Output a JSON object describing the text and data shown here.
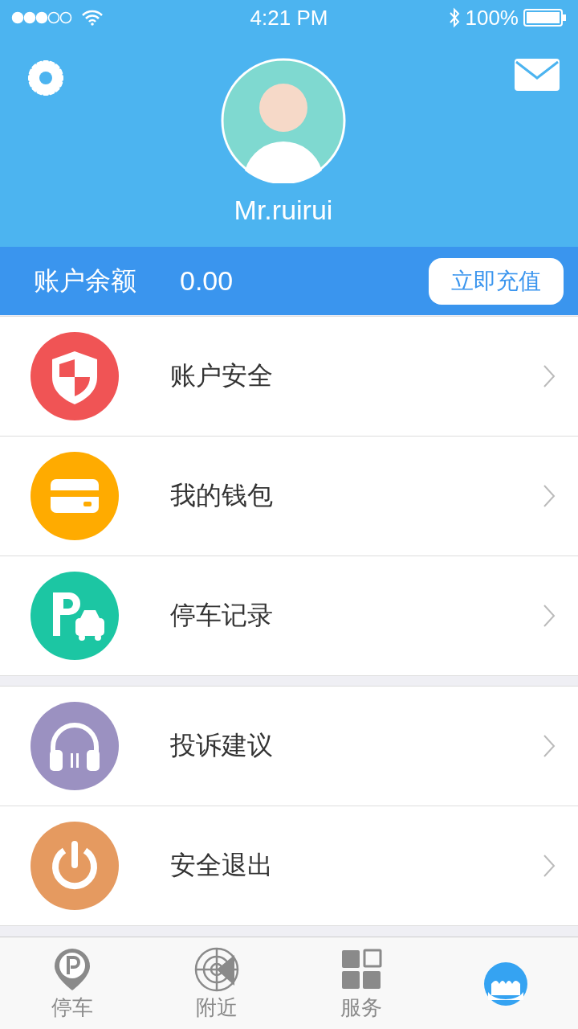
{
  "status_bar": {
    "time": "4:21 PM",
    "battery": "100%"
  },
  "profile": {
    "name": "Mr.ruirui"
  },
  "balance": {
    "label": "账户余额",
    "amount": "0.00",
    "button": "立即充值"
  },
  "menu_groups": [
    [
      {
        "label": "账户安全",
        "kind": "shield",
        "color": "#f05455"
      },
      {
        "label": "我的钱包",
        "kind": "wallet",
        "color": "#ffab00"
      },
      {
        "label": "停车记录",
        "kind": "parking",
        "color": "#1cc6a3"
      }
    ],
    [
      {
        "label": "投诉建议",
        "kind": "headphones",
        "color": "#9b91c1"
      },
      {
        "label": "安全退出",
        "kind": "power",
        "color": "#e59a60"
      }
    ]
  ],
  "tabs": [
    {
      "label": "停车",
      "kind": "parking",
      "selected": false
    },
    {
      "label": "附近",
      "kind": "radar",
      "selected": false
    },
    {
      "label": "服务",
      "kind": "grid",
      "selected": false
    },
    {
      "kind": "face",
      "selected": true
    }
  ]
}
